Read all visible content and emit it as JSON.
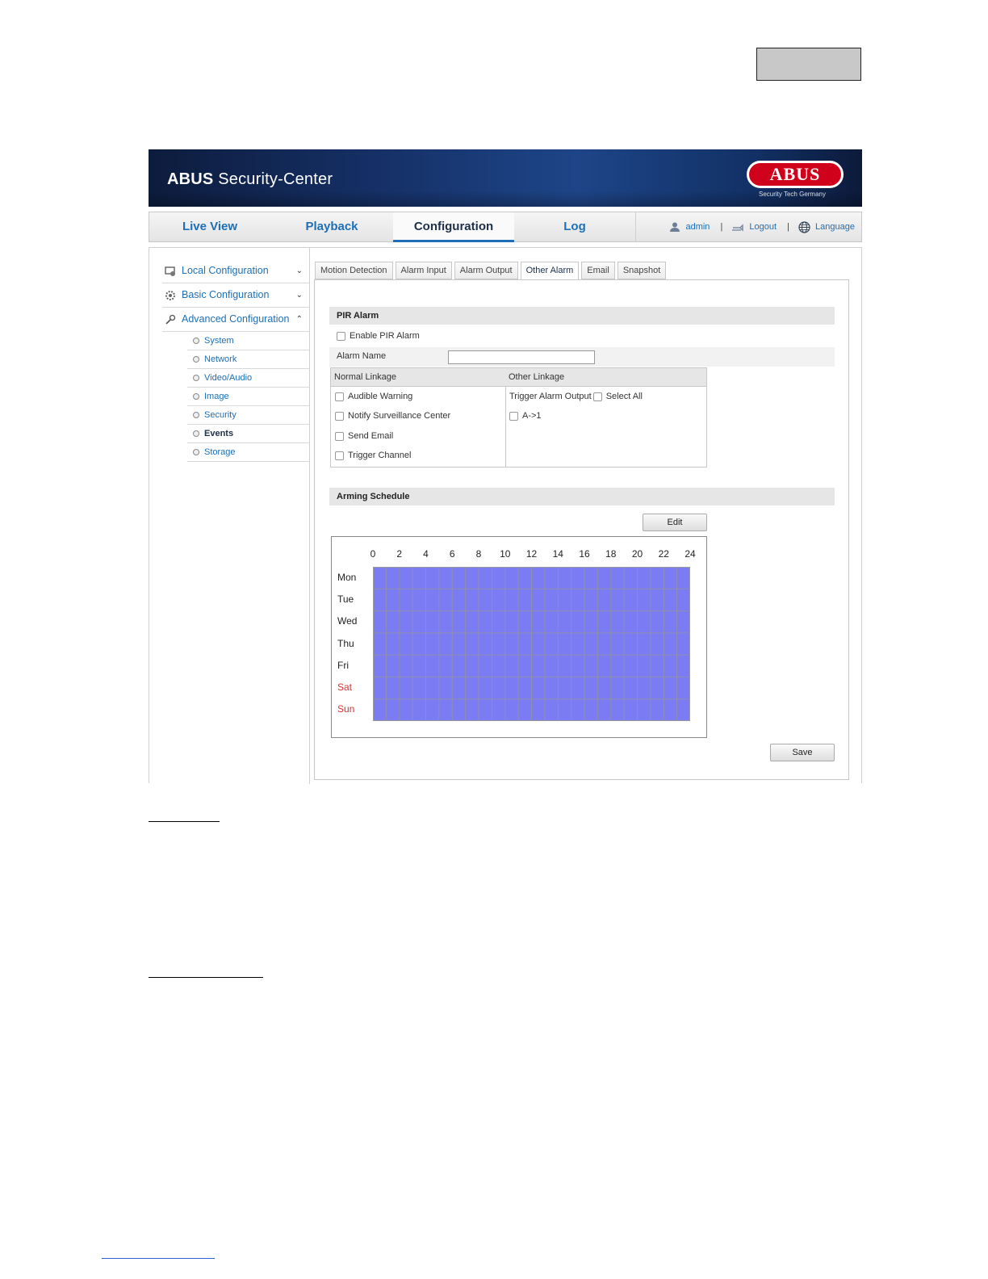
{
  "banner": {
    "title_bold": "ABUS",
    "title_rest": " Security-Center",
    "logo_text": "ABUS",
    "logo_sub": "Security Tech Germany"
  },
  "topnav": {
    "items": [
      {
        "label": "Live View"
      },
      {
        "label": "Playback"
      },
      {
        "label": "Configuration",
        "active": true
      },
      {
        "label": "Log"
      }
    ],
    "user": "admin",
    "logout": "Logout",
    "language": "Language",
    "divider": "|"
  },
  "sidebar": {
    "groups": [
      {
        "label": "Local Configuration",
        "chevron": "⌄"
      },
      {
        "label": "Basic Configuration",
        "chevron": "⌄"
      },
      {
        "label": "Advanced Configuration",
        "chevron": "⌃"
      }
    ],
    "sub_items": [
      "System",
      "Network",
      "Video/Audio",
      "Image",
      "Security",
      "Events",
      "Storage"
    ],
    "active_sub": "Events"
  },
  "tabs": [
    "Motion Detection",
    "Alarm Input",
    "Alarm Output",
    "Other Alarm",
    "Email",
    "Snapshot"
  ],
  "active_tab": "Other Alarm",
  "pir": {
    "section_title": "PIR Alarm",
    "enable_label": "Enable PIR Alarm",
    "enable_checked": false,
    "alarm_name_label": "Alarm Name",
    "alarm_name_value": ""
  },
  "linkage": {
    "normal_header": "Normal Linkage",
    "other_header": "Other Linkage",
    "normal_items": [
      "Audible Warning",
      "Notify Surveillance Center",
      "Send Email",
      "Trigger Channel"
    ],
    "trigger_output_label": "Trigger Alarm Output",
    "select_all_label": "Select All",
    "outputs": [
      "A->1"
    ]
  },
  "schedule": {
    "section_title": "Arming Schedule",
    "edit_button": "Edit",
    "hours": [
      "0",
      "2",
      "4",
      "6",
      "8",
      "10",
      "12",
      "14",
      "16",
      "18",
      "20",
      "22",
      "24"
    ],
    "days": [
      "Mon",
      "Tue",
      "Wed",
      "Thu",
      "Fri",
      "Sat",
      "Sun"
    ],
    "weekend_days": [
      "Sat",
      "Sun"
    ],
    "armed": "all days, 0–24",
    "fill_color": "#7b7bf3",
    "weekend_color": "#d9302c"
  },
  "save_button": "Save",
  "colors": {
    "accent": "#1d6fb6",
    "active_tab_underline": "#1f6db8",
    "banner_dark": "#0d1c3d"
  }
}
